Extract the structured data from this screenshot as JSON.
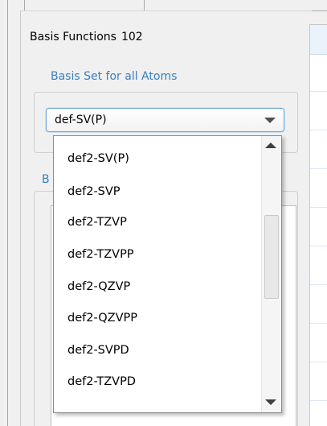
{
  "basis_info": {
    "label": "Basis Functions",
    "count": "102"
  },
  "basis_set_group": {
    "label": "Basis Set for all Atoms",
    "selected_value": "def-SV(P)"
  },
  "second_group": {
    "label_partial": "B"
  },
  "dropdown": {
    "options": [
      "def2-SV(P)",
      "def2-SVP",
      "def2-TZVP",
      "def2-TZVPP",
      "def2-QZVP",
      "def2-QZVPP",
      "def2-SVPD",
      "def2-TZVPD"
    ]
  },
  "colors": {
    "group_label": "#3a7fc1",
    "combo_focus_border": "#6ba5d8"
  },
  "icons": {
    "combo_arrow": "chevron-down-icon",
    "scroll_up": "scroll-up-arrow-icon",
    "scroll_down": "scroll-down-arrow-icon"
  }
}
